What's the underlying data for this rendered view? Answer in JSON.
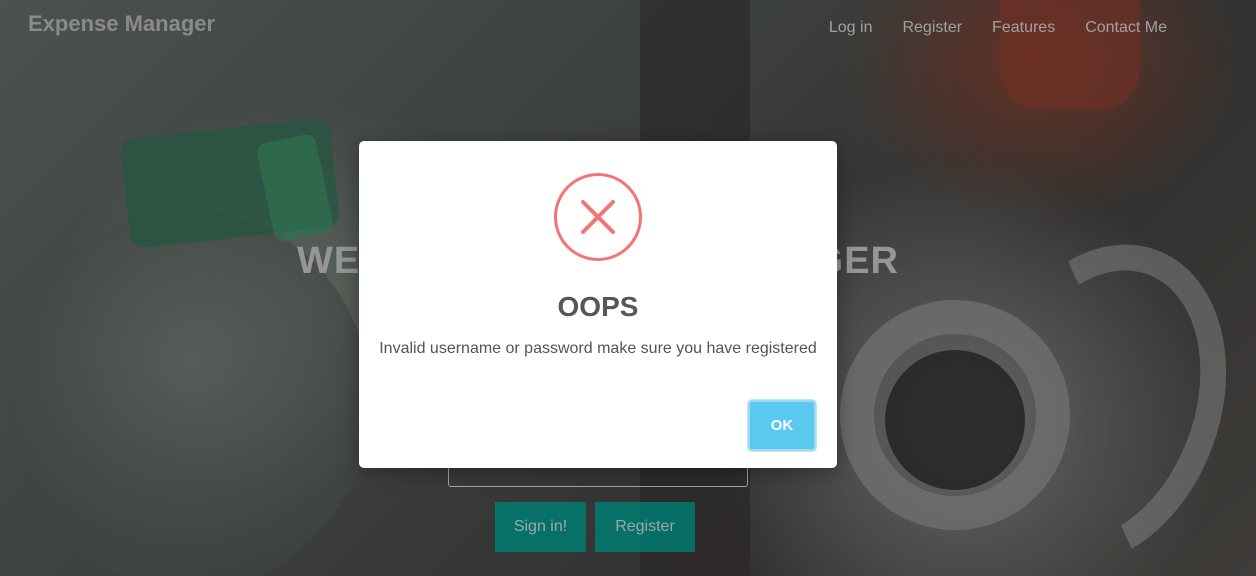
{
  "navbar": {
    "brand": "Expense Manager",
    "links": [
      "Log in",
      "Register",
      "Features",
      "Contact Me"
    ]
  },
  "hero": {
    "title_left_visible": "WEL",
    "title_right_visible": "GER"
  },
  "login_form": {
    "signin_label": "Sign in!",
    "register_label": "Register"
  },
  "modal": {
    "icon": "error-x-icon",
    "title": "OOPS",
    "message": "Invalid username or password make sure you have registered",
    "ok_label": "OK"
  },
  "colors": {
    "error_red": "#f27474",
    "ok_button": "#5bc8f0",
    "teal_button": "#00968a"
  }
}
